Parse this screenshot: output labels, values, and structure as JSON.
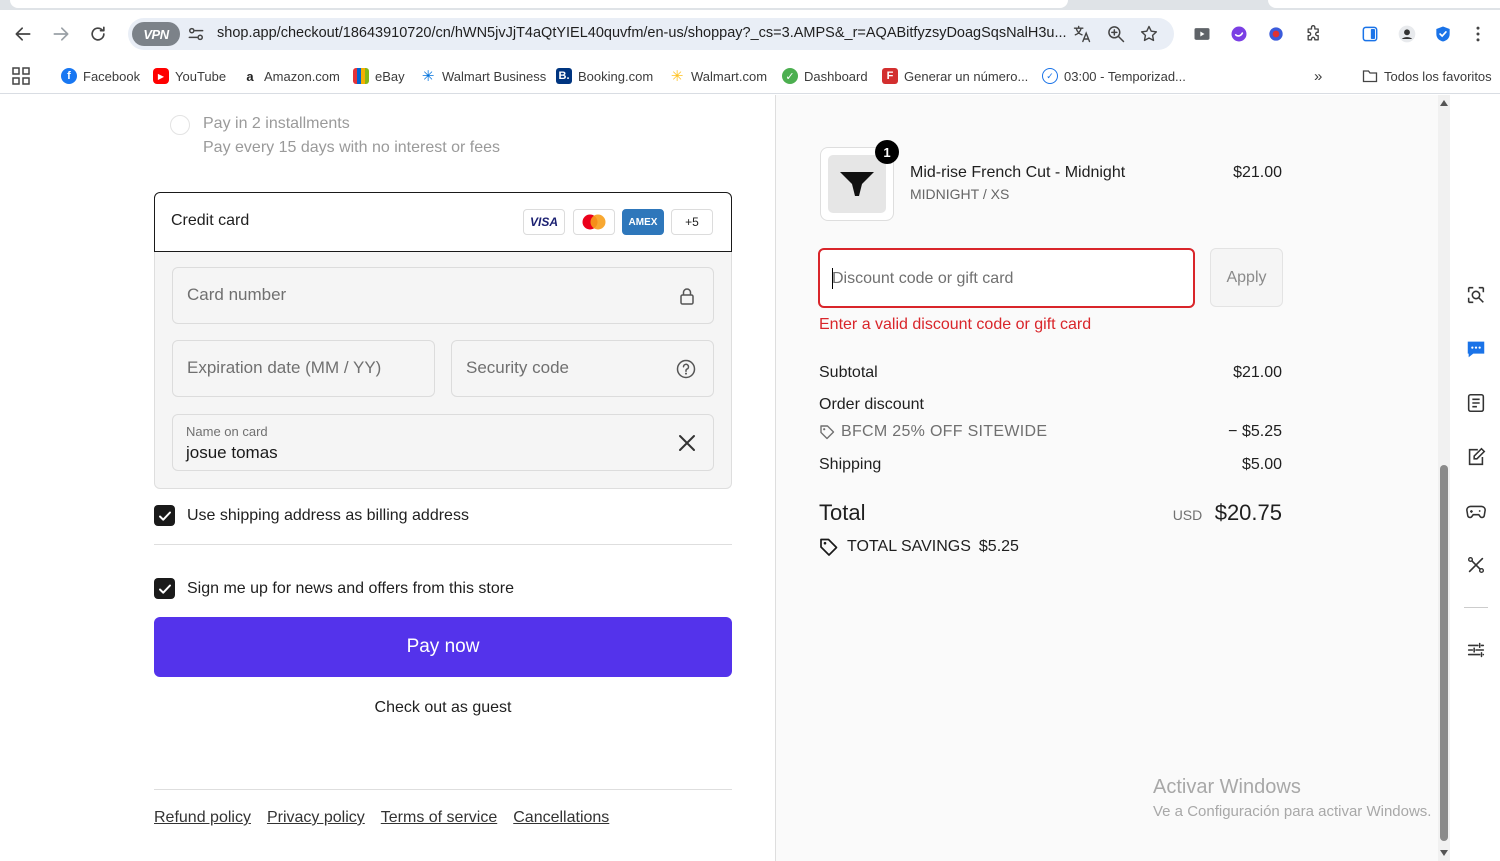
{
  "browser": {
    "vpn_label": "VPN",
    "url": "shop.app/checkout/18643910720/cn/hWN5jvJjT4aQtYIEL40quvfm/en-us/shoppay?_cs=3.AMPS&_r=AQABitfyzsyDoagSqsNalH3u...",
    "bookmarks": [
      {
        "label": "Facebook",
        "icon": "facebook-icon",
        "color": "#1877f2"
      },
      {
        "label": "YouTube",
        "icon": "youtube-icon",
        "color": "#ff0000"
      },
      {
        "label": "Amazon.com",
        "icon": "amazon-icon",
        "color": "#222222"
      },
      {
        "label": "eBay",
        "icon": "ebay-icon",
        "color": "#e53238"
      },
      {
        "label": "Walmart Business",
        "icon": "walmart-spark-icon",
        "color": "#0071dc"
      },
      {
        "label": "Booking.com",
        "icon": "booking-icon",
        "color": "#003580"
      },
      {
        "label": "Walmart.com",
        "icon": "walmart-spark-icon",
        "color": "#ffc220"
      },
      {
        "label": "Dashboard",
        "icon": "dashboard-icon",
        "color": "#4caf50"
      },
      {
        "label": "Generar un número...",
        "icon": "f-icon",
        "color": "#d32f2f"
      },
      {
        "label": "03:00 - Temporizad...",
        "icon": "timer-icon",
        "color": "#1a73e8"
      }
    ],
    "all_bookmarks_label": "Todos los favoritos"
  },
  "checkout": {
    "installments_title": "Pay in 2 installments",
    "installments_subtitle": "Pay every 15 days with no interest or fees",
    "credit_card_label": "Credit card",
    "card_brands": [
      "VISA",
      "Mastercard",
      "AMEX"
    ],
    "more_brands": "+5",
    "card_number_placeholder": "Card number",
    "expiration_placeholder": "Expiration date (MM / YY)",
    "security_code_placeholder": "Security code",
    "name_on_card_label": "Name on card",
    "name_on_card_value": "josue tomas",
    "billing_checkbox_label": "Use shipping address as billing address",
    "news_checkbox_label": "Sign me up for news and offers from this store",
    "pay_button": "Pay now",
    "guest_link": "Check out as guest",
    "footer_links": [
      "Refund policy",
      "Privacy policy",
      "Terms of service",
      "Cancellations"
    ],
    "accent_color": "#5433eb"
  },
  "summary": {
    "quantity_badge": "1",
    "product_name": "Mid-rise French Cut - Midnight",
    "product_variant": "MIDNIGHT / XS",
    "product_price": "$21.00",
    "discount_placeholder": "Discount code or gift card",
    "apply_button": "Apply",
    "discount_error": "Enter a valid discount code or gift card",
    "subtotal_label": "Subtotal",
    "subtotal_value": "$21.00",
    "order_discount_label": "Order discount",
    "discount_code": "BFCM 25% OFF SITEWIDE",
    "discount_value": "− $5.25",
    "shipping_label": "Shipping",
    "shipping_value": "$5.00",
    "total_label": "Total",
    "total_currency": "USD",
    "total_value": "$20.75",
    "savings_label": "TOTAL SAVINGS",
    "savings_value": "$5.25",
    "error_color": "#d9252a"
  },
  "watermark": {
    "title": "Activar Windows",
    "subtitle": "Ve a Configuración para activar Windows."
  }
}
